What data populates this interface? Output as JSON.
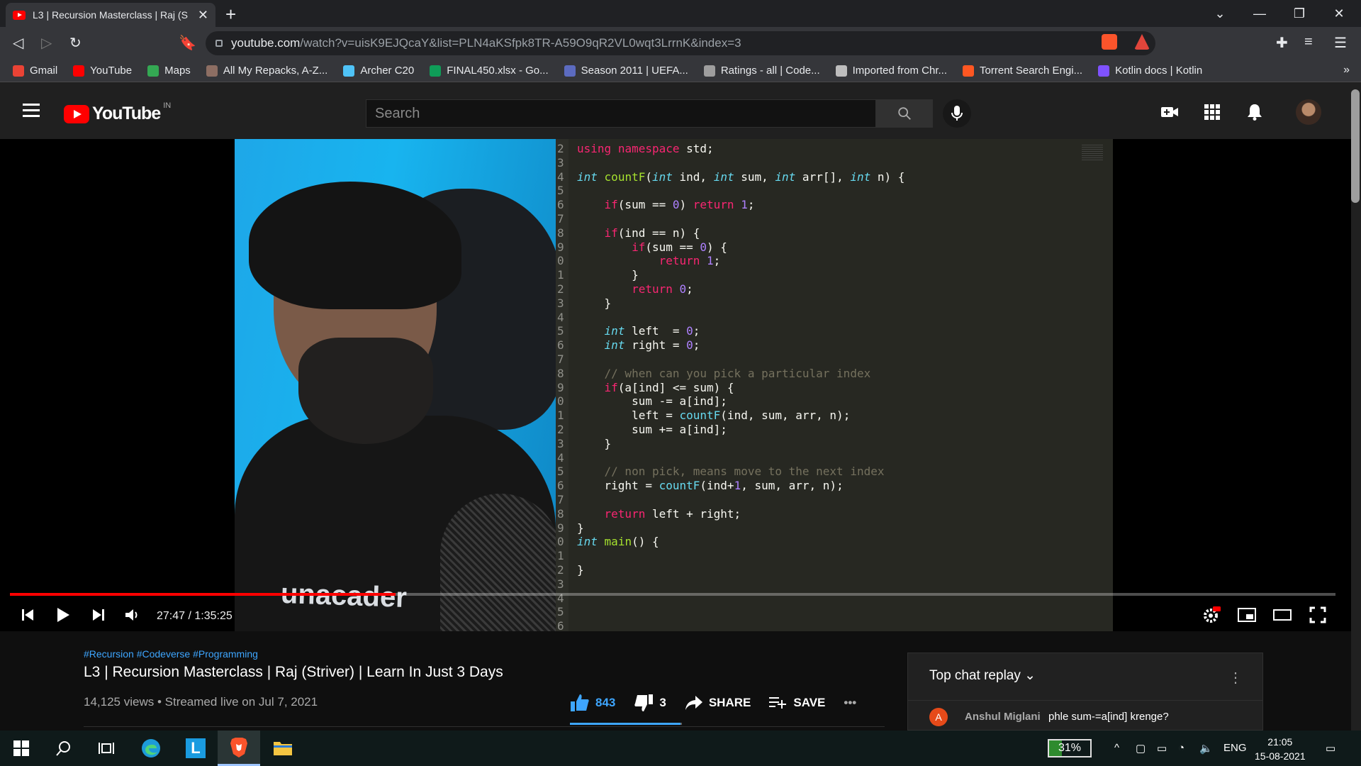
{
  "browser": {
    "tab_title": "L3 | Recursion Masterclass | Raj (S",
    "new_tab": "+",
    "url_host": "youtube.com",
    "url_path": "/watch?v=uisK9EJQcaY&list=PLN4aKSfpk8TR-A59O9qR2VL0wqt3LrrnK&index=3",
    "brave_count": "99+",
    "rewards_count": "1",
    "bookmarks": [
      {
        "label": "Gmail",
        "color": "#ea4335"
      },
      {
        "label": "YouTube",
        "color": "#ff0000"
      },
      {
        "label": "Maps",
        "color": "#34a853"
      },
      {
        "label": "All My Repacks, A-Z...",
        "color": "#8d6e63"
      },
      {
        "label": "Archer C20",
        "color": "#4fc3f7"
      },
      {
        "label": "FINAL450.xlsx - Go...",
        "color": "#0f9d58"
      },
      {
        "label": "Season 2011 | UEFA...",
        "color": "#5c6bc0"
      },
      {
        "label": "Ratings - all | Code...",
        "color": "#9e9e9e"
      },
      {
        "label": "Imported from Chr...",
        "color": "#bdbdbd"
      },
      {
        "label": "Torrent Search Engi...",
        "color": "#ff5722"
      },
      {
        "label": "Kotlin docs | Kotlin",
        "color": "#7f52ff"
      }
    ],
    "more_bookmarks": "»"
  },
  "youtube": {
    "logo_text": "YouTube",
    "country_code": "IN",
    "search_placeholder": "Search"
  },
  "player": {
    "time": "27:47 / 1:35:25",
    "progress_fraction": 0.291,
    "webcam_logo": "unacader",
    "code_lines": [
      {
        "n": "2",
        "html": "<span class='kw'>using</span> <span class='kw'>namespace</span> std;"
      },
      {
        "n": "3",
        "html": ""
      },
      {
        "n": "4",
        "html": "<span class='ty'>int</span> <span class='fn'>countF</span>(<span class='ty'>int</span> ind, <span class='ty'>int</span> sum, <span class='ty'>int</span> arr[], <span class='ty'>int</span> n) {"
      },
      {
        "n": "5",
        "html": ""
      },
      {
        "n": "6",
        "html": "    <span class='kw'>if</span>(sum == <span class='nm'>0</span>) <span class='kw'>return</span> <span class='nm'>1</span>;"
      },
      {
        "n": "7",
        "html": ""
      },
      {
        "n": "8",
        "html": "    <span class='kw'>if</span>(ind == n) {"
      },
      {
        "n": "9",
        "html": "        <span class='kw'>if</span>(sum == <span class='nm'>0</span>) {"
      },
      {
        "n": "0",
        "html": "            <span class='kw'>return</span> <span class='nm'>1</span>;"
      },
      {
        "n": "1",
        "html": "        }"
      },
      {
        "n": "2",
        "html": "        <span class='kw'>return</span> <span class='nm'>0</span>;"
      },
      {
        "n": "3",
        "html": "    }"
      },
      {
        "n": "4",
        "html": ""
      },
      {
        "n": "5",
        "html": "    <span class='ty'>int</span> left  = <span class='nm'>0</span>;"
      },
      {
        "n": "6",
        "html": "    <span class='ty'>int</span> right = <span class='nm'>0</span>;"
      },
      {
        "n": "7",
        "html": ""
      },
      {
        "n": "8",
        "html": "    <span class='cm'>// when can you pick a particular index</span>"
      },
      {
        "n": "9",
        "html": "    <span class='kw'>if</span>(a[ind] &lt;= sum) {"
      },
      {
        "n": "0",
        "html": "        sum -= a[ind];"
      },
      {
        "n": "1",
        "html": "        left = <span class='fn2'>countF</span>(ind, sum, arr, n);"
      },
      {
        "n": "2",
        "html": "        sum += a[ind];"
      },
      {
        "n": "3",
        "html": "    }"
      },
      {
        "n": "4",
        "html": ""
      },
      {
        "n": "5",
        "html": "    <span class='cm'>// non pick, means move to the next index</span>"
      },
      {
        "n": "6",
        "html": "    right = <span class='fn2'>countF</span>(ind+<span class='nm'>1</span>, sum, arr, n);"
      },
      {
        "n": "7",
        "html": ""
      },
      {
        "n": "8",
        "html": "    <span class='kw'>return</span> left + right;"
      },
      {
        "n": "9",
        "html": "}"
      },
      {
        "n": "0",
        "html": "<span class='ty'>int</span> <span class='fn'>main</span>() {"
      },
      {
        "n": "1",
        "html": ""
      },
      {
        "n": "2",
        "html": "}"
      },
      {
        "n": "3",
        "html": ""
      },
      {
        "n": "4",
        "html": ""
      },
      {
        "n": "5",
        "html": ""
      },
      {
        "n": "6",
        "html": ""
      }
    ]
  },
  "video": {
    "hashtags": "#Recursion #Codeverse #Programming",
    "title": "L3 | Recursion Masterclass | Raj (Striver) | Learn In Just 3 Days",
    "meta": "14,125 views • Streamed live on Jul 7, 2021",
    "likes": "843",
    "dislikes": "3",
    "share_label": "SHARE",
    "save_label": "SAVE",
    "more": "•••"
  },
  "chat": {
    "header": "Top chat replay",
    "messages": [
      {
        "initial": "A",
        "author": "Anshul Miglani",
        "text": "phle sum-=a[ind] krenge?"
      }
    ]
  },
  "taskbar": {
    "battery": "31%",
    "lang": "ENG",
    "time": "21:05",
    "date": "15-08-2021"
  },
  "colors": {
    "accent": "#ff0000",
    "link": "#3ea6ff"
  }
}
